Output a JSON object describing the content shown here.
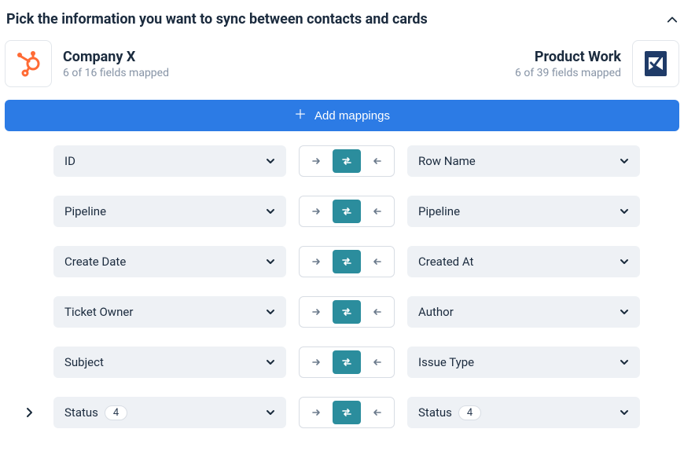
{
  "header": {
    "title": "Pick the information you want to sync between contacts and cards"
  },
  "left_app": {
    "name": "Company X",
    "subtitle": "6 of 16 fields mapped",
    "logo": "hubspot"
  },
  "right_app": {
    "name": "Product Work",
    "subtitle": "6 of 39 fields mapped",
    "logo": "check"
  },
  "add_button": {
    "label": "Add mappings"
  },
  "rows": [
    {
      "left": "ID",
      "right": "Row Name",
      "left_badge": null,
      "right_badge": null,
      "expand": false
    },
    {
      "left": "Pipeline",
      "right": "Pipeline",
      "left_badge": null,
      "right_badge": null,
      "expand": false
    },
    {
      "left": "Create Date",
      "right": "Created At",
      "left_badge": null,
      "right_badge": null,
      "expand": false
    },
    {
      "left": "Ticket Owner",
      "right": "Author",
      "left_badge": null,
      "right_badge": null,
      "expand": false
    },
    {
      "left": "Subject",
      "right": "Issue Type",
      "left_badge": null,
      "right_badge": null,
      "expand": false
    },
    {
      "left": "Status",
      "right": "Status",
      "left_badge": "4",
      "right_badge": "4",
      "expand": true
    }
  ]
}
